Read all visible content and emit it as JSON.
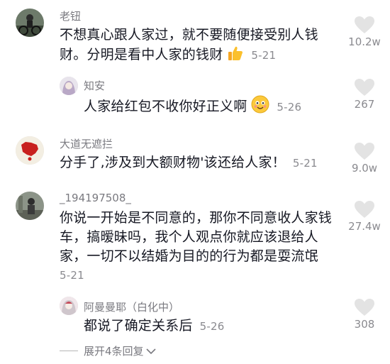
{
  "comments": [
    {
      "name": "老钮",
      "lines": [
        "不想真心跟人家过，就不要随便接受别人钱",
        "财。分明是看中人家的钱财"
      ],
      "date": "5-21",
      "likes": "10.2w",
      "emoji": "thumbs-up"
    },
    {
      "name": "知安",
      "lines": [
        "人家给红包不收你好正义啊"
      ],
      "date": "5-26",
      "likes": "267",
      "emoji": "smiling-face"
    },
    {
      "name": "大道无遮拦",
      "lines": [
        "分手了,涉及到大额财物'该还给人家！"
      ],
      "date": "5-21",
      "likes": "9.0w"
    },
    {
      "name": "_194197508_",
      "lines": [
        "你说一开始是不同意的，那你不同意收人家钱",
        "车，搞暧昧吗，我个人观点你就应该退给人",
        "家，一切不以结婚为目的的行为都是耍流氓"
      ],
      "date": "5-21",
      "likes": "27.4w"
    },
    {
      "name": "阿曼曼耶（白化中）",
      "lines": [
        "都说了确定关系后"
      ],
      "date": "5-26",
      "likes": "308"
    }
  ],
  "expand_label": "展开4条回复",
  "colors": {
    "text": "#161823",
    "meta": "#8a8a8f",
    "heart": "#e3e3e3"
  },
  "icons": [
    "heart-icon",
    "chevron-down-icon",
    "thumbs-up-emoji",
    "smiling-face-emoji"
  ]
}
